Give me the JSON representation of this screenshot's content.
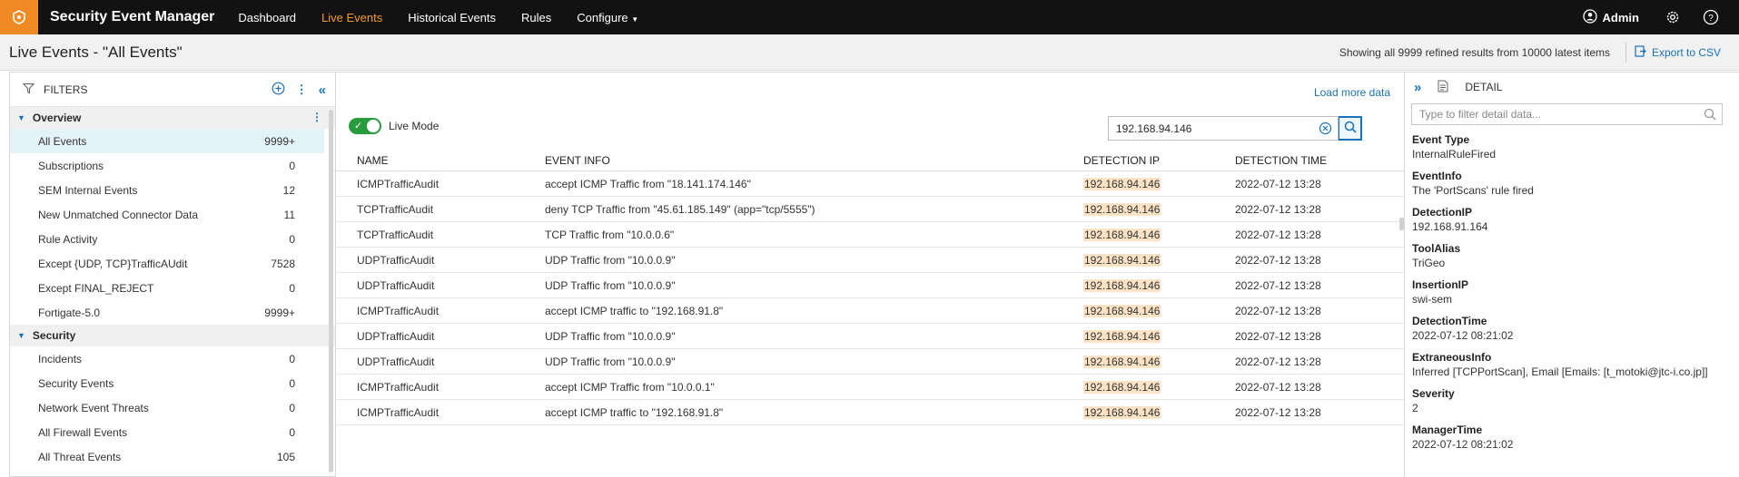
{
  "app": {
    "title": "Security Event Manager",
    "nav": [
      "Dashboard",
      "Live Events",
      "Historical Events",
      "Rules",
      "Configure"
    ],
    "active_nav": "Live Events",
    "user": "Admin"
  },
  "subheader": {
    "page_title": "Live Events - \"All Events\"",
    "showing": "Showing all 9999 refined results from 10000 latest items",
    "export": "Export to CSV"
  },
  "filters": {
    "title": "FILTERS",
    "groups": [
      {
        "name": "Overview",
        "items": [
          {
            "label": "All Events",
            "count": "9999+"
          },
          {
            "label": "Subscriptions",
            "count": "0"
          },
          {
            "label": "SEM Internal Events",
            "count": "12"
          },
          {
            "label": "New Unmatched Connector Data",
            "count": "11"
          },
          {
            "label": "Rule Activity",
            "count": "0"
          },
          {
            "label": "Except {UDP, TCP}TrafficAUdit",
            "count": "7528"
          },
          {
            "label": "Except FINAL_REJECT",
            "count": "0"
          },
          {
            "label": "Fortigate-5.0",
            "count": "9999+"
          }
        ]
      },
      {
        "name": "Security",
        "items": [
          {
            "label": "Incidents",
            "count": "0"
          },
          {
            "label": "Security Events",
            "count": "0"
          },
          {
            "label": "Network Event Threats",
            "count": "0"
          },
          {
            "label": "All Firewall Events",
            "count": "0"
          },
          {
            "label": "All Threat Events",
            "count": "105"
          }
        ]
      }
    ]
  },
  "events": {
    "load_more": "Load more data",
    "live_mode_label": "Live Mode",
    "search_value": "192.168.94.146",
    "columns": [
      "NAME",
      "EVENT INFO",
      "DETECTION IP",
      "DETECTION TIME"
    ],
    "rows": [
      {
        "name": "ICMPTrafficAudit",
        "info": "accept ICMP Traffic from \"18.141.174.146\"",
        "ip": "192.168.94.146",
        "time": "2022-07-12 13:28"
      },
      {
        "name": "TCPTrafficAudit",
        "info": "deny TCP Traffic from \"45.61.185.149\" (app=\"tcp/5555\")",
        "ip": "192.168.94.146",
        "time": "2022-07-12 13:28"
      },
      {
        "name": "TCPTrafficAudit",
        "info": "TCP Traffic from \"10.0.0.6\"",
        "ip": "192.168.94.146",
        "time": "2022-07-12 13:28"
      },
      {
        "name": "UDPTrafficAudit",
        "info": "UDP Traffic from \"10.0.0.9\"",
        "ip": "192.168.94.146",
        "time": "2022-07-12 13:28"
      },
      {
        "name": "UDPTrafficAudit",
        "info": "UDP Traffic from \"10.0.0.9\"",
        "ip": "192.168.94.146",
        "time": "2022-07-12 13:28"
      },
      {
        "name": "ICMPTrafficAudit",
        "info": "accept ICMP traffic to \"192.168.91.8\"",
        "ip": "192.168.94.146",
        "time": "2022-07-12 13:28"
      },
      {
        "name": "UDPTrafficAudit",
        "info": "UDP Traffic from \"10.0.0.9\"",
        "ip": "192.168.94.146",
        "time": "2022-07-12 13:28"
      },
      {
        "name": "UDPTrafficAudit",
        "info": "UDP Traffic from \"10.0.0.9\"",
        "ip": "192.168.94.146",
        "time": "2022-07-12 13:28"
      },
      {
        "name": "ICMPTrafficAudit",
        "info": "accept ICMP Traffic from \"10.0.0.1\"",
        "ip": "192.168.94.146",
        "time": "2022-07-12 13:28"
      },
      {
        "name": "ICMPTrafficAudit",
        "info": "accept ICMP traffic to \"192.168.91.8\"",
        "ip": "192.168.94.146",
        "time": "2022-07-12 13:28"
      }
    ]
  },
  "detail": {
    "title": "DETAIL",
    "filter_placeholder": "Type to filter detail data...",
    "fields": [
      {
        "key": "Event Type",
        "value": "InternalRuleFired"
      },
      {
        "key": "EventInfo",
        "value": "The 'PortScans' rule fired"
      },
      {
        "key": "DetectionIP",
        "value": "192.168.91.164"
      },
      {
        "key": "ToolAlias",
        "value": "TriGeo"
      },
      {
        "key": "InsertionIP",
        "value": "swi-sem"
      },
      {
        "key": "DetectionTime",
        "value": "2022-07-12 08:21:02"
      },
      {
        "key": "ExtraneousInfo",
        "value": "Inferred [TCPPortScan], Email [Emails: [t_motoki@jtc-i.co.jp]]"
      },
      {
        "key": "Severity",
        "value": "2"
      },
      {
        "key": "ManagerTime",
        "value": "2022-07-12 08:21:02"
      }
    ]
  },
  "colors": {
    "accent": "#f39a2b",
    "link": "#1a72b8",
    "toggle": "#2a9b3c",
    "highlight": "#fde3c5"
  }
}
